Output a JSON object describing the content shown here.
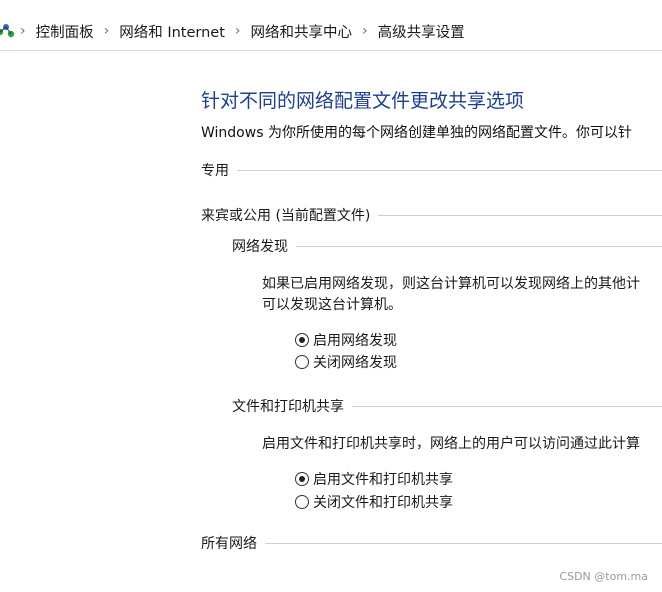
{
  "breadcrumb": {
    "items": [
      "控制面板",
      "网络和 Internet",
      "网络和共享中心",
      "高级共享设置"
    ],
    "separator_icon": "chevron-right-icon",
    "app_icon": "network-icon"
  },
  "main": {
    "title": "针对不同的网络配置文件更改共享选项",
    "description": "Windows 为你所使用的每个网络创建单独的网络配置文件。你可以针"
  },
  "sections": {
    "private": {
      "label": "专用"
    },
    "guest": {
      "label": "来宾或公用 (当前配置文件)",
      "network_discovery": {
        "label": "网络发现",
        "text_line1": "如果已启用网络发现，则这台计算机可以发现网络上的其他计",
        "text_line2": "可以发现这台计算机。",
        "options": [
          "启用网络发现",
          "关闭网络发现"
        ],
        "selected": "启用网络发现"
      },
      "file_sharing": {
        "label": "文件和打印机共享",
        "text": "启用文件和打印机共享时，网络上的用户可以访问通过此计算",
        "options": [
          "启用文件和打印机共享",
          "关闭文件和打印机共享"
        ],
        "selected": "启用文件和打印机共享"
      }
    },
    "all": {
      "label": "所有网络"
    }
  },
  "watermark": "CSDN @tom.ma",
  "colors": {
    "title": "#1c3f94",
    "divider": "#cfcfcf"
  }
}
